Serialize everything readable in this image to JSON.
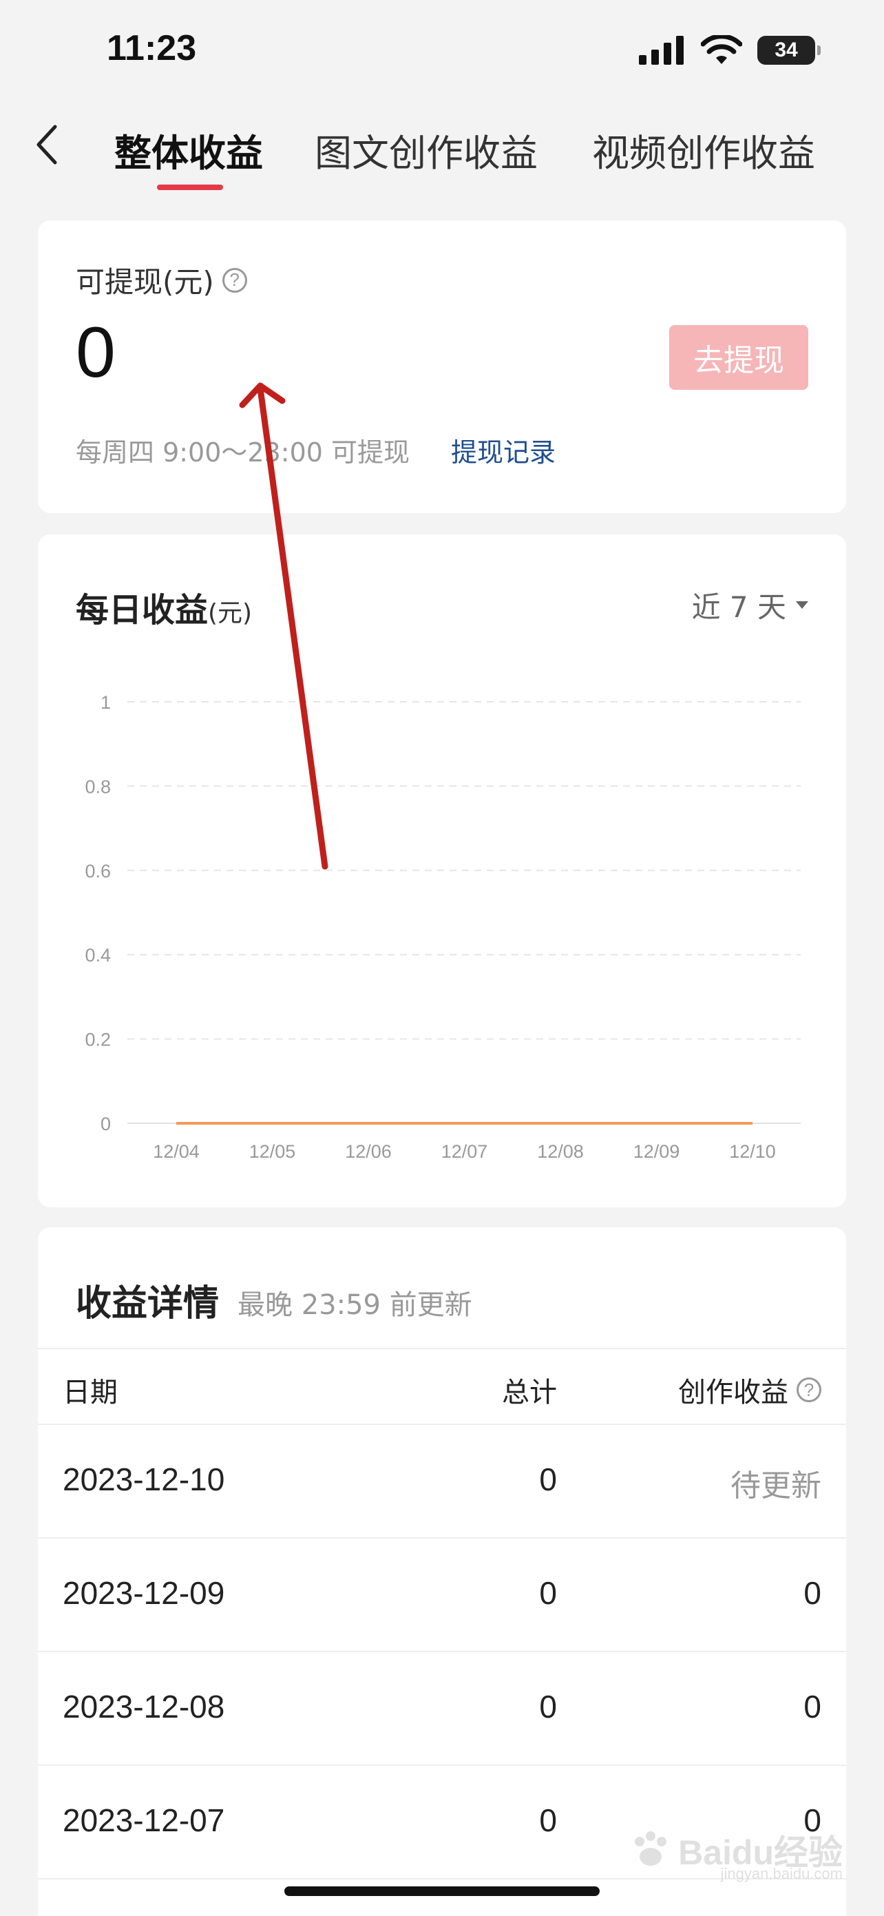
{
  "status_bar": {
    "time": "11:23",
    "battery": "34"
  },
  "nav": {
    "tabs": [
      {
        "label": "整体收益",
        "active": true
      },
      {
        "label": "图文创作收益",
        "active": false
      },
      {
        "label": "视频创作收益",
        "active": false
      }
    ],
    "accent_color": "#e53945"
  },
  "withdraw": {
    "label": "可提现(元)",
    "amount": "0",
    "button_label": "去提现",
    "schedule_note": "每周四 9:00～23:00 可提现",
    "record_link": "提现记录"
  },
  "daily": {
    "title": "每日收益",
    "unit": "(元)",
    "range_label": "近 7 天"
  },
  "chart_data": {
    "type": "line",
    "categories": [
      "12/04",
      "12/05",
      "12/06",
      "12/07",
      "12/08",
      "12/09",
      "12/10"
    ],
    "series": [
      {
        "values": [
          0,
          0,
          0,
          0,
          0,
          0,
          0
        ],
        "color": "#f29a5c"
      }
    ],
    "y_ticks": [
      "1",
      "0.8",
      "0.6",
      "0.4",
      "0.2",
      "0"
    ],
    "ylim": [
      0,
      1
    ],
    "grid": true
  },
  "detail": {
    "title": "收益详情",
    "subtitle": "最晚 23:59 前更新",
    "columns": [
      "日期",
      "总计",
      "创作收益"
    ],
    "rows": [
      {
        "date": "2023-12-10",
        "total": "0",
        "income": "待更新"
      },
      {
        "date": "2023-12-09",
        "total": "0",
        "income": "0"
      },
      {
        "date": "2023-12-08",
        "total": "0",
        "income": "0"
      },
      {
        "date": "2023-12-07",
        "total": "0",
        "income": "0"
      }
    ]
  },
  "watermark": {
    "text": "Baidu经验",
    "sub": "jingyan.baidu.com"
  }
}
